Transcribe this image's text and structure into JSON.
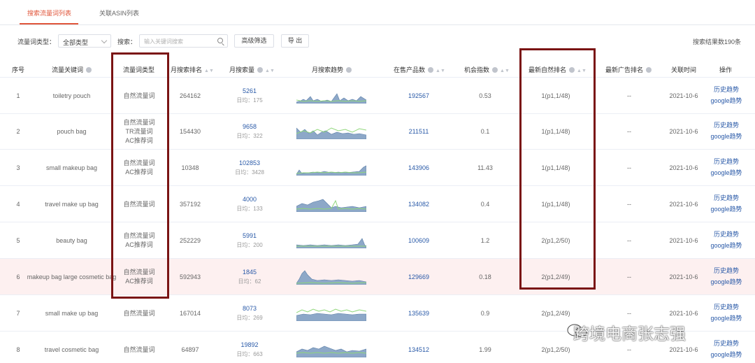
{
  "tabs": [
    {
      "label": "搜索流量词列表",
      "active": true
    },
    {
      "label": "关联ASIN列表",
      "active": false
    }
  ],
  "filters": {
    "type_label": "流量词类型：",
    "type_value": "全部类型",
    "search_label": "搜索：",
    "search_placeholder": "输入关键词搜索",
    "advanced_button": "高级筛选",
    "export_button": "导 出",
    "result_count": "搜索结果数190条"
  },
  "table": {
    "headers": {
      "index": "序号",
      "keyword": "流量关键词",
      "type": "流量词类型",
      "rank": "月搜索排名",
      "volume": "月搜索量",
      "trend": "月搜索趋势",
      "products": "在售产品数",
      "opportunity": "机会指数",
      "natural_rank": "最新自然排名",
      "ad_rank": "最新广告排名",
      "time": "关联时间",
      "ops": "操作"
    },
    "rows": [
      {
        "index": "1",
        "keyword": "toiletry pouch",
        "types": [
          "自然流量词"
        ],
        "rank": "264162",
        "volume": "5261",
        "daily": "日均：175",
        "products": "192567",
        "opportunity": "0.53",
        "natural_rank": "1(p1,1/48)",
        "ad_rank": "--",
        "time": "2021-10-6",
        "op1": "历史趋势",
        "op2": "google趋势",
        "highlight": false
      },
      {
        "index": "2",
        "keyword": "pouch bag",
        "types": [
          "自然流量词",
          "TR流量词",
          "AC推荐词"
        ],
        "rank": "154430",
        "volume": "9658",
        "daily": "日均：322",
        "products": "211511",
        "opportunity": "0.1",
        "natural_rank": "1(p1,1/48)",
        "ad_rank": "--",
        "time": "2021-10-6",
        "op1": "历史趋势",
        "op2": "google趋势",
        "highlight": false
      },
      {
        "index": "3",
        "keyword": "small makeup bag",
        "types": [
          "自然流量词",
          "AC推荐词"
        ],
        "rank": "10348",
        "volume": "102853",
        "daily": "日均：3428",
        "products": "143906",
        "opportunity": "11.43",
        "natural_rank": "1(p1,1/48)",
        "ad_rank": "--",
        "time": "2021-10-6",
        "op1": "历史趋势",
        "op2": "google趋势",
        "highlight": false
      },
      {
        "index": "4",
        "keyword": "travel make up bag",
        "types": [
          "自然流量词"
        ],
        "rank": "357192",
        "volume": "4000",
        "daily": "日均：133",
        "products": "134082",
        "opportunity": "0.4",
        "natural_rank": "1(p1,1/48)",
        "ad_rank": "--",
        "time": "2021-10-6",
        "op1": "历史趋势",
        "op2": "google趋势",
        "highlight": false
      },
      {
        "index": "5",
        "keyword": "beauty bag",
        "types": [
          "自然流量词",
          "AC推荐词"
        ],
        "rank": "252229",
        "volume": "5991",
        "daily": "日均：200",
        "products": "100609",
        "opportunity": "1.2",
        "natural_rank": "2(p1,2/50)",
        "ad_rank": "--",
        "time": "2021-10-6",
        "op1": "历史趋势",
        "op2": "google趋势",
        "highlight": false
      },
      {
        "index": "6",
        "keyword": "makeup bag large cosmetic bag",
        "types": [
          "自然流量词",
          "AC推荐词"
        ],
        "rank": "592943",
        "volume": "1845",
        "daily": "日均：62",
        "products": "129669",
        "opportunity": "0.18",
        "natural_rank": "2(p1,2/49)",
        "ad_rank": "--",
        "time": "2021-10-6",
        "op1": "历史趋势",
        "op2": "google趋势",
        "highlight": true
      },
      {
        "index": "7",
        "keyword": "small make up bag",
        "types": [
          "自然流量词"
        ],
        "rank": "167014",
        "volume": "8073",
        "daily": "日均：269",
        "products": "135639",
        "opportunity": "0.9",
        "natural_rank": "2(p1,2/49)",
        "ad_rank": "--",
        "time": "2021-10-6",
        "op1": "历史趋势",
        "op2": "google趋势",
        "highlight": false
      },
      {
        "index": "8",
        "keyword": "travel cosmetic bag",
        "types": [
          "自然流量词"
        ],
        "rank": "64897",
        "volume": "19892",
        "daily": "日均：663",
        "products": "134512",
        "opportunity": "1.99",
        "natural_rank": "2(p1,2/50)",
        "ad_rank": "--",
        "time": "2021-10-6",
        "op1": "历史趋势",
        "op2": "google趋势",
        "highlight": false
      }
    ]
  },
  "watermark": "跨境电商张志强",
  "colors": {
    "accent": "#e0553a",
    "link": "#2a5aa8",
    "annotation": "#7a1414",
    "spark_fill": "#8da8c8",
    "spark_line": "#8fd67a"
  }
}
